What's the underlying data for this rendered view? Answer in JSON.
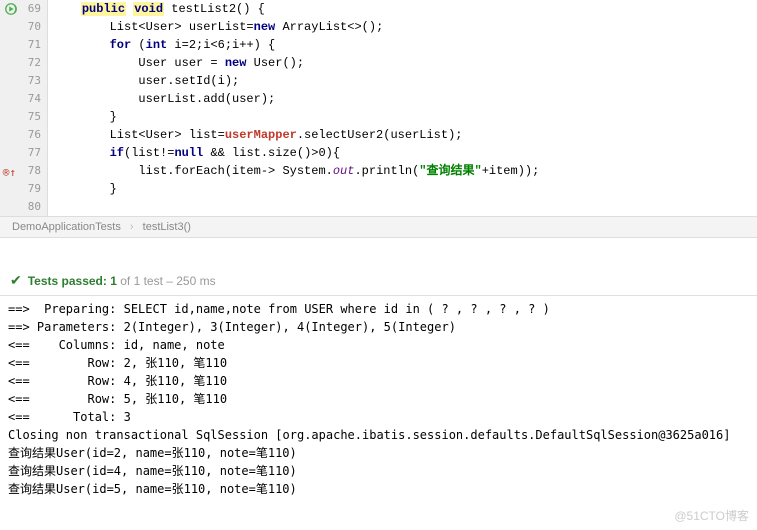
{
  "gutter": {
    "start": 69,
    "end": 80,
    "runIconLine": 69,
    "markIconLine": 78
  },
  "code": {
    "l69_pre": "    ",
    "l69_kw1": "public",
    "l69_sp1": " ",
    "l69_kw2": "void",
    "l69_sp2": " ",
    "l69_txt": "testList2() {",
    "l70": "        List<User> userList=",
    "l70_kw": "new",
    "l70_b": " ArrayList<>();",
    "l71": "        ",
    "l71_kw1": "for",
    "l71_a": " (",
    "l71_kw2": "int",
    "l71_b": " i=2;i<6;i++) {",
    "l72": "            User user = ",
    "l72_kw": "new",
    "l72_b": " User();",
    "l73": "            user.setId(i);",
    "l74": "            userList.add(user);",
    "l75": "        }",
    "l76": "        List<User> list=",
    "l76_fn": "userMapper",
    "l76_b": ".selectUser2(userList);",
    "l77": "        ",
    "l77_kw": "if",
    "l77_a": "(list!=",
    "l77_kw2": "null",
    "l77_b": " && list.size()>0){",
    "l78": "            list.forEach(item-> System.",
    "l78_fd": "out",
    "l78_b": ".println(",
    "l78_str": "\"查询结果\"",
    "l78_c": "+item));",
    "l79": "        }"
  },
  "breadcrumb": {
    "item1": "DemoApplicationTests",
    "item2": "testList3()"
  },
  "testStatus": {
    "passed": "Tests passed: 1",
    "rest": " of 1 test – 250 ms"
  },
  "console": {
    "l1": "==>  Preparing: SELECT id,name,note from USER where id in ( ? , ? , ? , ? )",
    "l2": "==> Parameters: 2(Integer), 3(Integer), 4(Integer), 5(Integer)",
    "l3": "<==    Columns: id, name, note",
    "l4": "<==        Row: 2, 张110, 笔110",
    "l5": "<==        Row: 4, 张110, 笔110",
    "l6": "<==        Row: 5, 张110, 笔110",
    "l7": "<==      Total: 3",
    "l8": "Closing non transactional SqlSession [org.apache.ibatis.session.defaults.DefaultSqlSession@3625a016]",
    "l9": "查询结果User(id=2, name=张110, note=笔110)",
    "l10": "查询结果User(id=4, name=张110, note=笔110)",
    "l11": "查询结果User(id=5, name=张110, note=笔110)"
  },
  "watermark": "@51CTO博客"
}
